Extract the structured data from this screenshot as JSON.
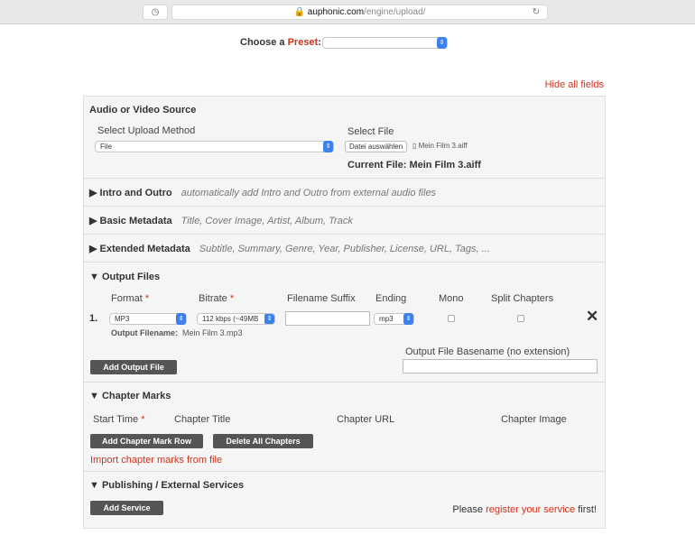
{
  "browser": {
    "url_domain": "auphonic.com",
    "url_path": "/engine/upload/"
  },
  "preset": {
    "label_prefix": "Choose a ",
    "label_accent": "Preset",
    ":": ":",
    "value": ""
  },
  "hide_all_fields": "Hide all fields",
  "source": {
    "title": "Audio or Video Source",
    "upload_method_label": "Select Upload Method",
    "upload_method_value": "File",
    "select_file_label": "Select File",
    "choose_file_button": "Datei auswählen",
    "chosen_file": "Mein Film 3.aiff",
    "current_file": "Current File: Mein Film 3.aiff"
  },
  "sections": [
    {
      "title": "Intro and Outro",
      "desc": "automatically add Intro and Outro from external audio files"
    },
    {
      "title": "Basic Metadata",
      "desc": "Title, Cover Image, Artist, Album, Track"
    },
    {
      "title": "Extended Metadata",
      "desc": "Subtitle, Summary, Genre, Year, Publisher, License, URL, Tags, ..."
    }
  ],
  "output": {
    "title": "Output Files",
    "headers": {
      "format": "Format",
      "bitrate": "Bitrate",
      "suffix": "Filename Suffix",
      "ending": "Ending",
      "mono": "Mono",
      "split": "Split Chapters"
    },
    "required": "*",
    "rows": [
      {
        "num": "1.",
        "format": "MP3",
        "bitrate": "112 kbps (~49MB",
        "suffix": "",
        "ending": "mp3",
        "mono": false,
        "split": false,
        "filename_label": "Output Filename:",
        "filename": "Mein Film 3.mp3"
      }
    ],
    "add_button": "Add Output File",
    "basename_label": "Output File Basename (no extension)",
    "basename_value": ""
  },
  "chapters": {
    "title": "Chapter Marks",
    "headers": {
      "start": "Start Time",
      "title": "Chapter Title",
      "url": "Chapter URL",
      "image": "Chapter Image"
    },
    "add_button": "Add Chapter Mark Row",
    "delete_button": "Delete All Chapters",
    "import_link": "Import chapter marks from file"
  },
  "publishing": {
    "title": "Publishing / External Services",
    "add_button": "Add Service",
    "note_prefix": "Please ",
    "note_link": "register your service",
    "note_suffix": " first!"
  },
  "colors": {
    "accent": "#d0321c",
    "button": "#555555",
    "select_arrow": "#3b82f0"
  }
}
